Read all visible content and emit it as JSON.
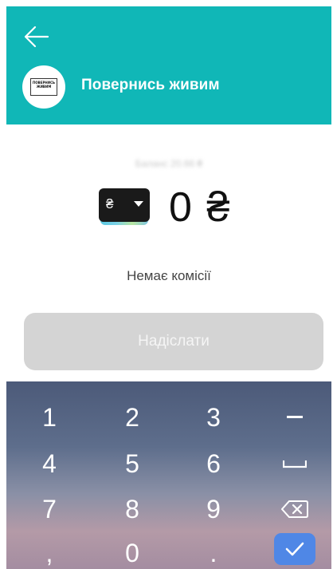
{
  "header": {
    "title": "Повернись живим",
    "logo_lines": [
      "ПОВЕРНИСЬ",
      "ЖИВИМ"
    ]
  },
  "balance_text": "Баланс 20.66 ₴",
  "currency": {
    "symbol": "₴"
  },
  "amount": {
    "value": "0",
    "symbol": "₴"
  },
  "fee_text": "Немає комісії",
  "send_button_label": "Надіслати",
  "keypad": {
    "keys": [
      "1",
      "2",
      "3",
      "−",
      "4",
      "5",
      "6",
      "␣",
      "7",
      "8",
      "9",
      "⌫",
      ",",
      "0",
      "."
    ]
  },
  "colors": {
    "header": "#10b7b7",
    "confirm": "#4f87e6",
    "send_disabled": "#d4d4d4"
  }
}
